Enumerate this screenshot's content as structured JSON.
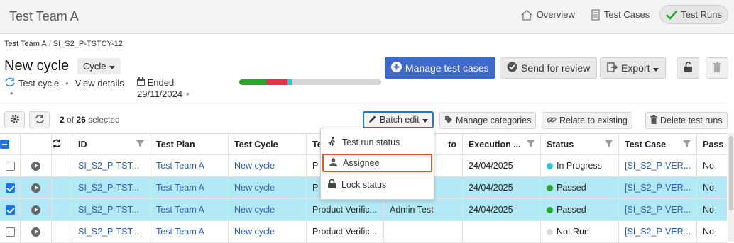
{
  "header": {
    "team_name": "Test Team A",
    "nav": [
      {
        "label": "Overview",
        "icon": "home-icon"
      },
      {
        "label": "Test Cases",
        "icon": "document-icon"
      },
      {
        "label": "Test Runs",
        "icon": "checkmark-icon",
        "active": true
      }
    ]
  },
  "breadcrumb": {
    "items": [
      "Test Team A",
      "SI_S2_P-TSTCY-12"
    ],
    "separator": "/"
  },
  "cycle": {
    "title": "New cycle",
    "type_dropdown": "Cycle",
    "subtitle_type": "Test cycle",
    "view_details": "View details",
    "status_label": "Ended",
    "end_date": "29/11/2024",
    "progress": [
      {
        "status": "Passed",
        "fraction": 0.19,
        "color": "#2aa52a"
      },
      {
        "status": "Failed",
        "fraction": 0.15,
        "color": "#e2334a"
      },
      {
        "status": "In Progress",
        "fraction": 0.03,
        "color": "#26c6d6"
      },
      {
        "status": "Not Run",
        "fraction": 0.63,
        "color": "#d6d6d6"
      }
    ]
  },
  "actions": {
    "manage_test_cases": "Manage test cases",
    "send_for_review": "Send for review",
    "export": "Export"
  },
  "toolbar": {
    "selected_count": "2",
    "of_text": "of",
    "total": "26",
    "selected_suffix": "selected",
    "batch_edit": "Batch edit",
    "manage_categories": "Manage categories",
    "relate_to_existing": "Relate to existing",
    "delete_test_runs": "Delete test runs"
  },
  "batch_menu": {
    "items": [
      {
        "label": "Test run status",
        "icon": "runner-icon"
      },
      {
        "label": "Assignee",
        "icon": "person-icon",
        "highlighted": true
      },
      {
        "label": "Lock status",
        "icon": "lock-icon"
      }
    ]
  },
  "table": {
    "columns": [
      "ID",
      "Test Plan",
      "Test Cycle",
      "Te",
      "to",
      "Execution ...",
      "Status",
      "Test Case",
      "Pass"
    ],
    "rows": [
      {
        "checked": false,
        "id": "SI_S2_P-TST...",
        "plan": "Test Team A",
        "cycle": "New cycle",
        "test": "P",
        "assignee": "",
        "execution": "24/04/2025",
        "status": "In Progress",
        "status_color": "#26c6d6",
        "test_case": "[SI_S2_P-VER...",
        "pass": "No"
      },
      {
        "checked": true,
        "id": "SI_S2_P-TST...",
        "plan": "Test Team A",
        "cycle": "New cycle",
        "test": "P",
        "assignee": "",
        "execution": "24/04/2025",
        "status": "Passed",
        "status_color": "#2aa52a",
        "test_case": "[SI_S2_P-VER...",
        "pass": "No"
      },
      {
        "checked": true,
        "id": "SI_S2_P-TST...",
        "plan": "Test Team A",
        "cycle": "New cycle",
        "test": "Product Verific...",
        "assignee": "Admin Test",
        "execution": "24/04/2025",
        "status": "Passed",
        "status_color": "#2aa52a",
        "test_case": "[SI_S2_P-VER...",
        "pass": "No"
      },
      {
        "checked": false,
        "id": "SI_S2_P-TST...",
        "plan": "Test Team A",
        "cycle": "New cycle",
        "test": "Product Verific...",
        "assignee": "",
        "execution": "",
        "status": "Not Run",
        "status_color": "#d9d9d9",
        "test_case": "[SI_S2_P-VER...",
        "pass": "No"
      }
    ]
  },
  "colors": {
    "primary": "#3f6ac9",
    "selected_row": "#b3e8f5",
    "link": "#2a5db0",
    "menu_highlight": "#e0572a"
  }
}
